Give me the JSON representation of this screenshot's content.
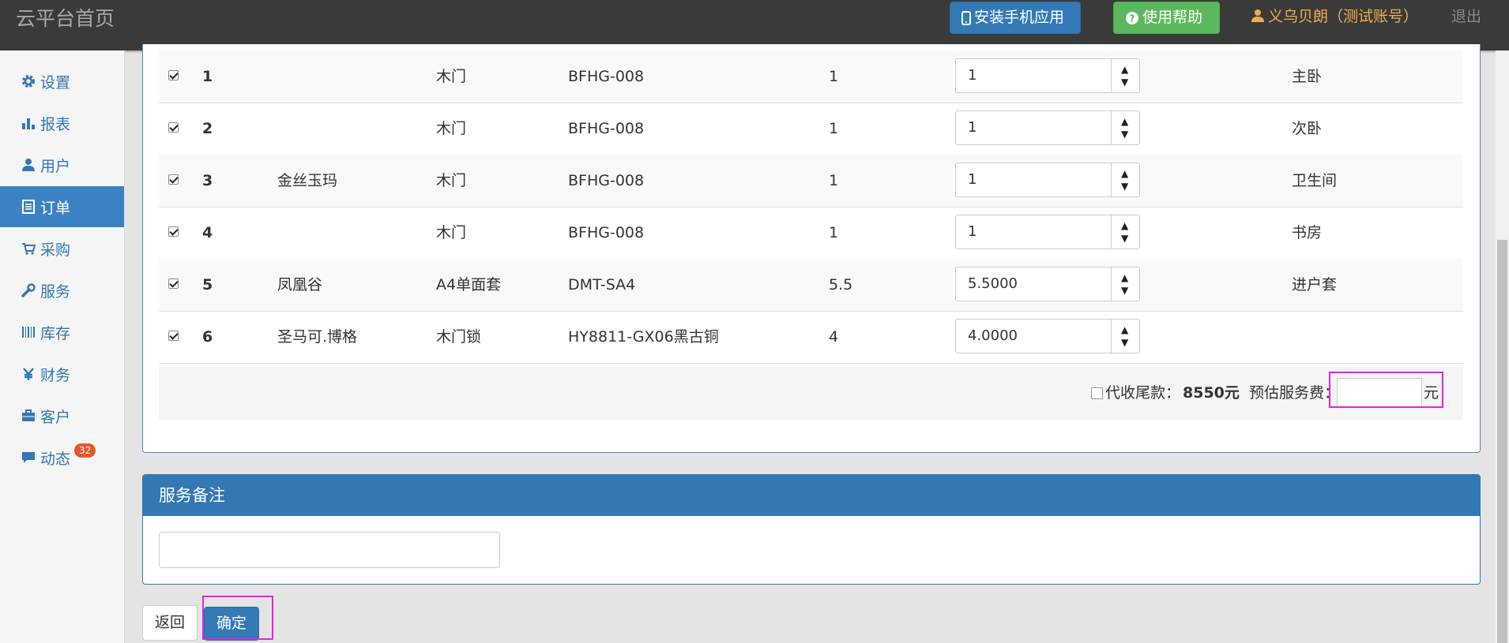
{
  "topbar": {
    "brand": "云平台首页",
    "install_app_label": "安装手机应用",
    "help_label": "使用帮助",
    "user_label": "义乌贝朗（测试账号）",
    "logout_label": "退出"
  },
  "sidebar": {
    "items": [
      {
        "label": "设置",
        "icon": "gear-icon"
      },
      {
        "label": "报表",
        "icon": "bar-chart-icon"
      },
      {
        "label": "用户",
        "icon": "user-icon"
      },
      {
        "label": "订单",
        "icon": "list-icon",
        "active": true
      },
      {
        "label": "采购",
        "icon": "cart-icon"
      },
      {
        "label": "服务",
        "icon": "wrench-icon"
      },
      {
        "label": "库存",
        "icon": "barcode-icon"
      },
      {
        "label": "财务",
        "icon": "yen-icon"
      },
      {
        "label": "客户",
        "icon": "briefcase-icon"
      },
      {
        "label": "动态",
        "icon": "comment-icon",
        "badge": "32"
      }
    ]
  },
  "order_items": {
    "rows": [
      {
        "no": "1",
        "name": "",
        "type": "木门",
        "model": "BFHG-008",
        "qty": "1",
        "service_qty": "1",
        "room": "主卧",
        "checked": true
      },
      {
        "no": "2",
        "name": "",
        "type": "木门",
        "model": "BFHG-008",
        "qty": "1",
        "service_qty": "1",
        "room": "次卧",
        "checked": true
      },
      {
        "no": "3",
        "name": "金丝玉玛",
        "type": "木门",
        "model": "BFHG-008",
        "qty": "1",
        "service_qty": "1",
        "room": "卫生间",
        "checked": true
      },
      {
        "no": "4",
        "name": "",
        "type": "木门",
        "model": "BFHG-008",
        "qty": "1",
        "service_qty": "1",
        "room": "书房",
        "checked": true
      },
      {
        "no": "5",
        "name": "凤凰谷",
        "type": "A4单面套",
        "model": "DMT-SA4",
        "qty": "5.5",
        "service_qty": "5.5000",
        "room": "进户套",
        "checked": true
      },
      {
        "no": "6",
        "name": "圣马可.博格",
        "type": "木门锁",
        "model": "HY8811-GX06黑古铜",
        "qty": "4",
        "service_qty": "4.0000",
        "room": "",
        "checked": true
      }
    ],
    "cod_label": "代收尾款：",
    "cod_amount": "8550元",
    "fee_label": "预估服务费：",
    "fee_value": "",
    "fee_unit": "元"
  },
  "remark": {
    "title": "服务备注",
    "value": ""
  },
  "actions": {
    "back_label": "返回",
    "confirm_label": "确定"
  },
  "colors": {
    "primary": "#337ab7",
    "success": "#5cb85c",
    "warning": "#f0ad4e",
    "highlight": "#e621e6",
    "badge": "#e8562a"
  }
}
